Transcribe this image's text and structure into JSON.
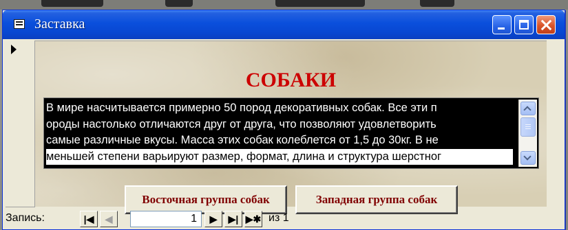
{
  "window": {
    "title": "Заставка",
    "controls": {
      "minimize_icon": "minimize-icon",
      "maximize_icon": "maximize-icon",
      "close_icon": "close-icon"
    }
  },
  "form": {
    "heading": "СОБАКИ",
    "memo_lines": [
      "В мире насчитывается примерно 50 пород декоративных собак. Все эти п",
      "ороды настолько отличаются друг от друга, что позволяют удовлетворить",
      "самые различные вкусы. Масса этих собак колеблется от 1,5 до 30кг. В не",
      "меньшей степени варьируют размер, формат, длина и структура шерстног"
    ],
    "buttons": {
      "east": "Восточная группа собак",
      "west": "Западная группа собак"
    }
  },
  "navigator": {
    "label": "Запись:",
    "current_record": "1",
    "of_text": "из  1",
    "icons": {
      "first": "first-record-icon",
      "prev": "previous-record-icon",
      "next": "next-record-icon",
      "last": "last-record-icon",
      "new": "new-record-icon"
    }
  },
  "colors": {
    "heading": "#cc0000",
    "button_text": "#800000",
    "titlebar": "#0846d0"
  }
}
